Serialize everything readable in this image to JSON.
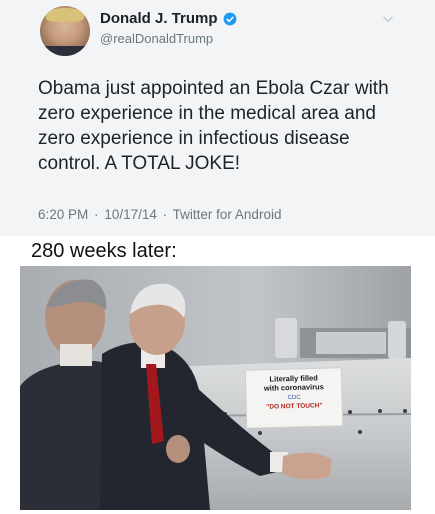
{
  "tweet": {
    "display_name": "Donald J. Trump",
    "handle": "@realDonaldTrump",
    "verified": true,
    "text": "Obama just appointed an Ebola Czar with zero experience in the medical area and zero experience in infectious disease control. A TOTAL JOKE!",
    "time": "6:20 PM",
    "date": "10/17/14",
    "separator": "·",
    "source": "Twitter for Android",
    "icons": [
      "verified-badge-icon",
      "chevron-down-icon"
    ],
    "colors": {
      "verified": "#1d9bf0",
      "card_background": "#f2f4f5",
      "meta_text": "#6b7780"
    }
  },
  "caption": "280 weeks later:",
  "photo": {
    "note": {
      "line1": "Literally filled",
      "line2": "with coronavirus",
      "label": "CDC",
      "line3": "\"DO NOT TOUCH\""
    }
  }
}
